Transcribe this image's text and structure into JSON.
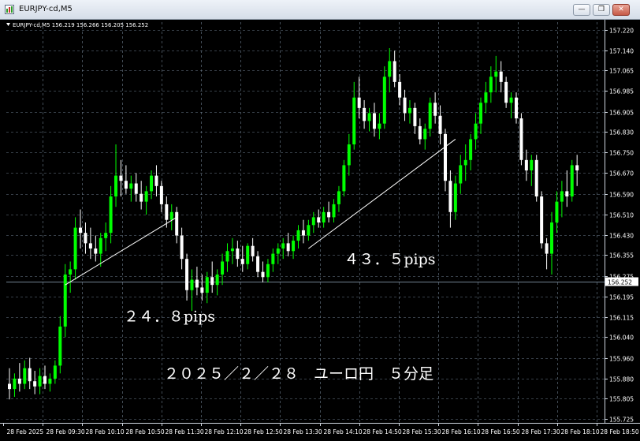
{
  "window": {
    "title": "EURJPY-cd,M5",
    "minimize_glyph": "—",
    "restore_glyph": "❐",
    "close_glyph": "✕"
  },
  "chart_data": {
    "type": "candlestick",
    "symbol_info": "EURJPY-cd,M5  156.219 156.266 156.205 156.252",
    "background": "#000000",
    "bull_color": "#00ff00",
    "bear_color": "#ffffff",
    "grid": true,
    "ylim": [
      155.71,
      157.25
    ],
    "y_ticks": [
      157.22,
      157.14,
      157.065,
      156.985,
      156.905,
      156.83,
      156.75,
      156.67,
      156.59,
      156.51,
      156.43,
      156.355,
      156.275,
      156.195,
      156.115,
      156.04,
      155.96,
      155.88,
      155.805,
      155.725
    ],
    "x_tick_labels": [
      "28 Feb 2025",
      "28 Feb 09:30",
      "28 Feb 10:10",
      "28 Feb 10:50",
      "28 Feb 11:30",
      "28 Feb 12:10",
      "28 Feb 12:50",
      "28 Feb 13:30",
      "28 Feb 14:10",
      "28 Feb 14:50",
      "28 Feb 15:30",
      "28 Feb 16:10",
      "28 Feb 16:50",
      "28 Feb 17:30",
      "28 Feb 18:10",
      "28 Feb 18:50"
    ],
    "current_price": 156.252,
    "current_price_label": "156.252",
    "candles": [
      [
        155.86,
        155.92,
        155.8,
        155.84
      ],
      [
        155.84,
        155.9,
        155.81,
        155.88
      ],
      [
        155.88,
        155.94,
        155.83,
        155.86
      ],
      [
        155.86,
        155.95,
        155.84,
        155.92
      ],
      [
        155.92,
        155.96,
        155.84,
        155.87
      ],
      [
        155.87,
        155.91,
        155.82,
        155.85
      ],
      [
        155.85,
        155.92,
        155.82,
        155.89
      ],
      [
        155.89,
        155.93,
        155.84,
        155.86
      ],
      [
        155.86,
        155.9,
        155.83,
        155.88
      ],
      [
        155.88,
        155.95,
        155.86,
        155.93
      ],
      [
        155.93,
        156.12,
        155.9,
        156.08
      ],
      [
        156.08,
        156.32,
        156.04,
        156.28
      ],
      [
        156.28,
        156.33,
        156.21,
        156.3
      ],
      [
        156.3,
        156.5,
        156.26,
        156.46
      ],
      [
        156.46,
        156.53,
        156.38,
        156.44
      ],
      [
        156.44,
        156.48,
        156.36,
        156.4
      ],
      [
        156.4,
        156.46,
        156.34,
        156.38
      ],
      [
        156.38,
        156.43,
        156.33,
        156.36
      ],
      [
        156.36,
        156.44,
        156.31,
        156.42
      ],
      [
        156.42,
        156.48,
        156.37,
        156.44
      ],
      [
        156.44,
        156.62,
        156.4,
        156.58
      ],
      [
        156.58,
        156.78,
        156.54,
        156.66
      ],
      [
        156.66,
        156.72,
        156.58,
        156.64
      ],
      [
        156.64,
        156.7,
        156.59,
        156.61
      ],
      [
        156.61,
        156.66,
        156.56,
        156.63
      ],
      [
        156.63,
        156.67,
        156.56,
        156.59
      ],
      [
        156.59,
        156.64,
        156.53,
        156.56
      ],
      [
        156.56,
        156.62,
        156.51,
        156.6
      ],
      [
        156.6,
        156.68,
        156.57,
        156.66
      ],
      [
        156.66,
        156.7,
        156.58,
        156.62
      ],
      [
        156.62,
        156.64,
        156.52,
        156.55
      ],
      [
        156.55,
        156.58,
        156.46,
        156.49
      ],
      [
        156.49,
        156.55,
        156.45,
        156.52
      ],
      [
        156.52,
        156.54,
        156.4,
        156.43
      ],
      [
        156.43,
        156.46,
        156.3,
        156.34
      ],
      [
        156.34,
        156.36,
        156.18,
        156.22
      ],
      [
        156.22,
        156.3,
        156.14,
        156.26
      ],
      [
        156.26,
        156.31,
        156.2,
        156.23
      ],
      [
        156.23,
        156.28,
        156.18,
        156.21
      ],
      [
        156.21,
        156.29,
        156.17,
        156.27
      ],
      [
        156.27,
        156.33,
        156.21,
        156.24
      ],
      [
        156.24,
        156.3,
        156.2,
        156.28
      ],
      [
        156.28,
        156.36,
        156.24,
        156.33
      ],
      [
        156.33,
        156.4,
        156.29,
        156.37
      ],
      [
        156.37,
        156.42,
        156.32,
        156.38
      ],
      [
        156.38,
        156.41,
        156.31,
        156.34
      ],
      [
        156.34,
        156.39,
        156.29,
        156.32
      ],
      [
        156.32,
        156.4,
        156.3,
        156.39
      ],
      [
        156.39,
        156.42,
        156.33,
        156.35
      ],
      [
        156.35,
        156.37,
        156.27,
        156.29
      ],
      [
        156.29,
        156.33,
        156.25,
        156.27
      ],
      [
        156.27,
        156.34,
        156.25,
        156.32
      ],
      [
        156.32,
        156.38,
        156.29,
        156.36
      ],
      [
        156.36,
        156.4,
        156.32,
        156.38
      ],
      [
        156.38,
        156.42,
        156.34,
        156.4
      ],
      [
        156.4,
        156.44,
        156.35,
        156.37
      ],
      [
        156.37,
        156.43,
        156.34,
        156.41
      ],
      [
        156.41,
        156.47,
        156.38,
        156.45
      ],
      [
        156.45,
        156.49,
        156.4,
        156.43
      ],
      [
        156.43,
        156.49,
        156.41,
        156.47
      ],
      [
        156.47,
        156.52,
        156.44,
        156.5
      ],
      [
        156.5,
        156.53,
        156.46,
        156.48
      ],
      [
        156.48,
        156.54,
        156.46,
        156.52
      ],
      [
        156.52,
        156.56,
        156.48,
        156.5
      ],
      [
        156.5,
        156.57,
        156.48,
        156.55
      ],
      [
        156.55,
        156.62,
        156.52,
        156.6
      ],
      [
        156.6,
        156.72,
        156.58,
        156.7
      ],
      [
        156.7,
        156.82,
        156.66,
        156.78
      ],
      [
        156.78,
        157.02,
        156.76,
        156.96
      ],
      [
        156.96,
        157.04,
        156.88,
        156.92
      ],
      [
        156.92,
        156.95,
        156.84,
        156.87
      ],
      [
        156.87,
        156.92,
        156.83,
        156.9
      ],
      [
        156.9,
        156.94,
        156.81,
        156.84
      ],
      [
        156.84,
        156.9,
        156.8,
        156.86
      ],
      [
        156.86,
        157.08,
        156.84,
        157.04
      ],
      [
        157.04,
        157.15,
        156.98,
        157.1
      ],
      [
        157.1,
        157.14,
        157.0,
        157.02
      ],
      [
        157.02,
        157.05,
        156.93,
        156.96
      ],
      [
        156.96,
        156.99,
        156.87,
        156.9
      ],
      [
        156.9,
        156.95,
        156.86,
        156.92
      ],
      [
        156.92,
        156.94,
        156.82,
        156.85
      ],
      [
        156.85,
        156.88,
        156.78,
        156.8
      ],
      [
        156.8,
        156.86,
        156.76,
        156.84
      ],
      [
        156.84,
        156.96,
        156.81,
        156.94
      ],
      [
        156.94,
        156.98,
        156.86,
        156.89
      ],
      [
        156.89,
        156.93,
        156.78,
        156.82
      ],
      [
        156.82,
        156.84,
        156.6,
        156.64
      ],
      [
        156.64,
        156.68,
        156.46,
        156.52
      ],
      [
        156.52,
        156.66,
        156.49,
        156.63
      ],
      [
        156.63,
        156.74,
        156.59,
        156.7
      ],
      [
        156.7,
        156.78,
        156.64,
        156.72
      ],
      [
        156.72,
        156.82,
        156.68,
        156.8
      ],
      [
        156.8,
        156.9,
        156.76,
        156.86
      ],
      [
        156.86,
        156.96,
        156.82,
        156.94
      ],
      [
        156.94,
        157.02,
        156.9,
        156.98
      ],
      [
        156.98,
        157.08,
        156.94,
        157.04
      ],
      [
        157.04,
        157.12,
        156.98,
        157.06
      ],
      [
        157.06,
        157.1,
        156.98,
        157.02
      ],
      [
        157.02,
        157.04,
        156.92,
        156.94
      ],
      [
        156.94,
        156.98,
        156.88,
        156.96
      ],
      [
        156.96,
        156.98,
        156.86,
        156.88
      ],
      [
        156.88,
        156.9,
        156.7,
        156.72
      ],
      [
        156.72,
        156.76,
        156.64,
        156.68
      ],
      [
        156.68,
        156.74,
        156.62,
        156.72
      ],
      [
        156.72,
        156.74,
        156.56,
        156.58
      ],
      [
        156.58,
        156.6,
        156.38,
        156.4
      ],
      [
        156.4,
        156.42,
        156.3,
        156.36
      ],
      [
        156.36,
        156.52,
        156.28,
        156.48
      ],
      [
        156.48,
        156.6,
        156.44,
        156.56
      ],
      [
        156.56,
        156.64,
        156.5,
        156.6
      ],
      [
        156.6,
        156.68,
        156.54,
        156.58
      ],
      [
        156.58,
        156.72,
        156.56,
        156.7
      ],
      [
        156.7,
        156.74,
        156.62,
        156.68
      ]
    ],
    "trendlines": [
      {
        "from_index": 11,
        "from_price": 156.24,
        "to_index": 33,
        "to_price": 156.5
      },
      {
        "from_index": 59,
        "from_price": 156.38,
        "to_index": 88,
        "to_price": 156.8
      }
    ],
    "annotations": [
      {
        "text": "２４．８pips",
        "x_index": 23,
        "price": 156.1
      },
      {
        "text": "４３．５pips",
        "x_index": 73,
        "price": 156.32
      },
      {
        "text": "２０２５／２／２８　ユーロ円　５分足",
        "x_index": 57,
        "price": 155.88
      }
    ]
  }
}
